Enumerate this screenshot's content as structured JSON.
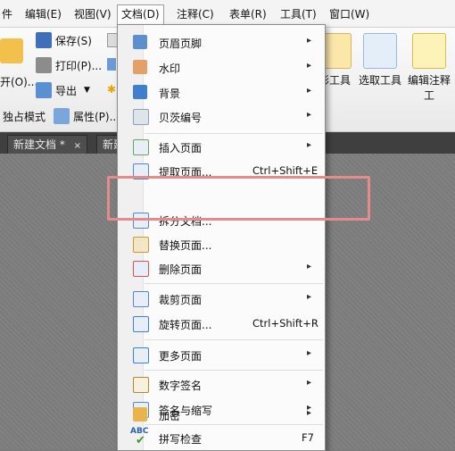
{
  "menubar": {
    "items": [
      "件",
      "编辑(E)",
      "视图(V)",
      "文档(D)",
      "注释(C)",
      "表单(R)",
      "工具(T)",
      "窗口(W)"
    ]
  },
  "ribbon": {
    "save": "保存(S)",
    "print": "打印(P)...",
    "export": "导出",
    "open_partial": "开(O)...",
    "exclusive_mode": "独占模式",
    "properties": "属性(P)...",
    "tools": [
      "形工具",
      "选取工具",
      "编辑注释工"
    ]
  },
  "tabs": [
    "新建文档 *",
    "新建"
  ],
  "document_menu": {
    "items": [
      {
        "label": "页眉页脚",
        "submenu": true,
        "icon": "header-footer-icon"
      },
      {
        "label": "水印",
        "submenu": true,
        "icon": "watermark-icon"
      },
      {
        "label": "背景",
        "submenu": true,
        "icon": "background-icon"
      },
      {
        "label": "贝茨编号",
        "submenu": true,
        "icon": "bates-number-icon"
      },
      {
        "label": "插入页面",
        "submenu": true,
        "icon": "insert-page-icon"
      },
      {
        "label": "提取页面...",
        "shortcut": "Ctrl+Shift+E",
        "icon": "extract-page-icon"
      },
      {
        "label": "拆分文档...",
        "icon": "split-document-icon"
      },
      {
        "label": "替换页面...",
        "icon": "replace-page-icon"
      },
      {
        "label": "删除页面",
        "submenu": true,
        "icon": "delete-page-icon"
      },
      {
        "label": "裁剪页面",
        "submenu": true,
        "icon": "crop-page-icon"
      },
      {
        "label": "旋转页面...",
        "shortcut": "Ctrl+Shift+R",
        "icon": "rotate-page-icon"
      },
      {
        "label": "更多页面",
        "submenu": true,
        "icon": "more-pages-icon"
      },
      {
        "label": "数字签名",
        "submenu": true,
        "icon": "digital-signature-icon"
      },
      {
        "label": "签名与缩写",
        "submenu": true,
        "icon": "sign-initial-icon"
      },
      {
        "label": "加密",
        "submenu": true,
        "icon": "encrypt-icon"
      },
      {
        "label": "拼写检查",
        "shortcut": "F7",
        "icon": "spell-check-icon",
        "icon_text": "ABC"
      }
    ],
    "submenu_arrow": "▸"
  },
  "colors": {
    "highlight_box": "#e48b8b",
    "menu_bg": "#fbfbfb",
    "tabbar": "#3f3f3f"
  }
}
